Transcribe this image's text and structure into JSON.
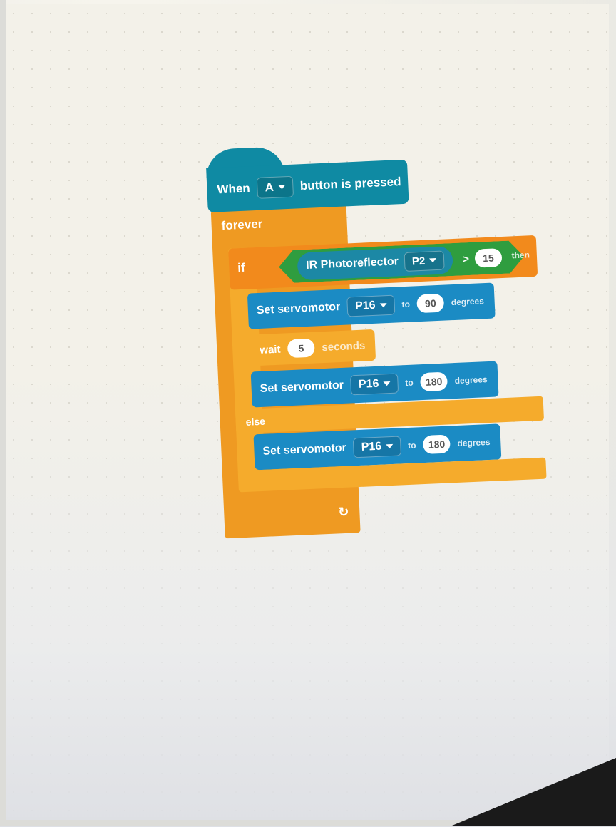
{
  "hat_block": {
    "when_label": "When",
    "button_value": "A",
    "pressed_label": "button is pressed",
    "color": "#0f8aa3"
  },
  "forever_block": {
    "label": "forever",
    "color": "#ef9a22"
  },
  "if_block": {
    "if_label": "if",
    "then_label": "then",
    "else_label": "else",
    "condition": {
      "sensor_label": "IR Photoreflector",
      "pin_value": "P2",
      "operator": ">",
      "threshold": "15"
    }
  },
  "statements": {
    "servo_1": {
      "label": "Set servomotor",
      "pin": "P16",
      "to_label": "to",
      "value": "90",
      "unit": "degrees"
    },
    "wait": {
      "label": "wait",
      "value": "5",
      "unit": "seconds"
    },
    "servo_2": {
      "label": "Set servomotor",
      "pin": "P16",
      "to_label": "to",
      "value": "180",
      "unit": "degrees"
    },
    "servo_3": {
      "label": "Set servomotor",
      "pin": "P16",
      "to_label": "to",
      "value": "180",
      "unit": "degrees"
    }
  },
  "colors": {
    "control_orange": "#f5ab2c",
    "servo_blue": "#1b8bc4",
    "condition_green": "#2f9d3f"
  },
  "icons": {
    "dropdown": "chevron-down-icon",
    "loop": "loop-arrow-icon"
  }
}
